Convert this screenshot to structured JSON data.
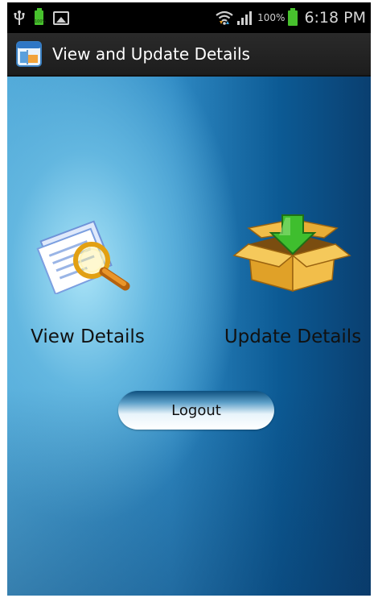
{
  "status_bar": {
    "battery_percent": "100%",
    "time": "6:18 PM",
    "small_battery_text": "100%"
  },
  "title_bar": {
    "title": "View and Update Details"
  },
  "main": {
    "view_label": "View Details",
    "update_label": "Update Details",
    "logout_label": "Logout"
  },
  "colors": {
    "status_bar_bg": "#000000",
    "title_bar_bg": "#1d1d1d",
    "battery_green": "#47c12d",
    "background_blue": "#2f8ac4"
  },
  "icons": [
    "usb-icon",
    "battery-icon",
    "picture-icon",
    "wifi-icon",
    "signal-icon",
    "app-icon",
    "magnifier-document-icon",
    "box-download-icon"
  ]
}
